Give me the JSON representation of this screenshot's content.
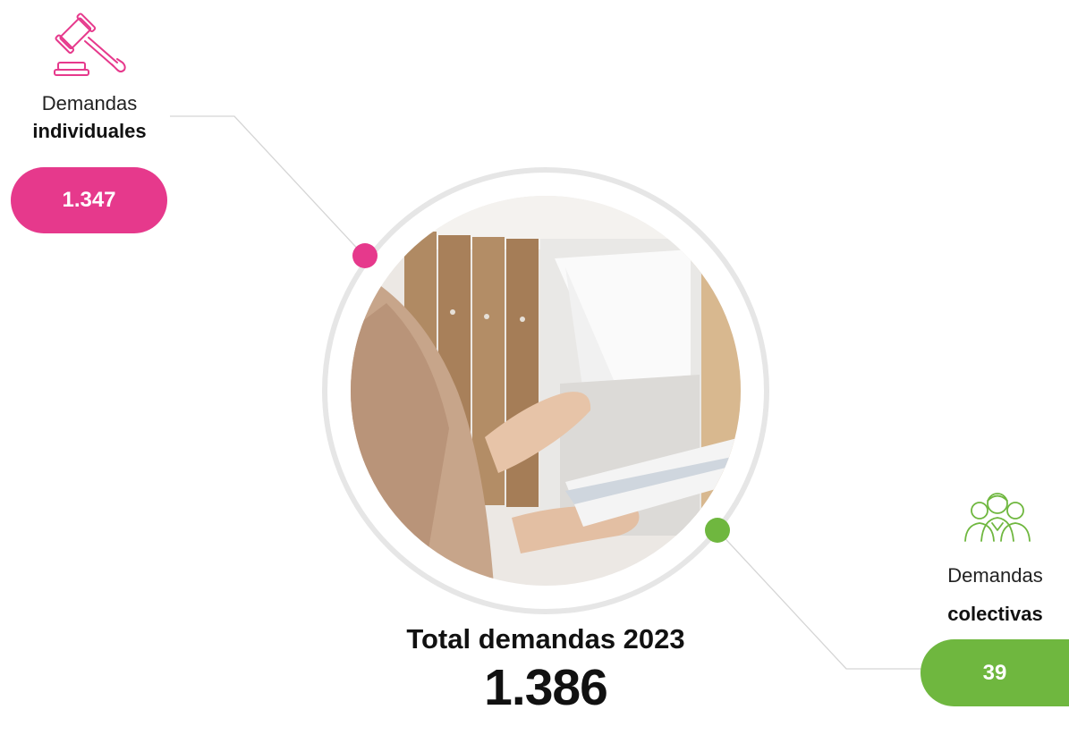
{
  "colors": {
    "pink": "#e6398c",
    "green": "#6fb73f",
    "ring": "#e6e6e6",
    "line": "#d5d5d5"
  },
  "individual": {
    "icon": "gavel-icon",
    "label_light": "Demandas",
    "label_bold": "individuales",
    "value": "1.347"
  },
  "collective": {
    "icon": "group-of-people-icon",
    "label_light": "Demandas",
    "label_bold": "colectivas",
    "value": "39"
  },
  "total": {
    "title": "Total demandas 2023",
    "value": "1.386"
  },
  "photo": {
    "subject": "hands-filing-documents-photo"
  }
}
